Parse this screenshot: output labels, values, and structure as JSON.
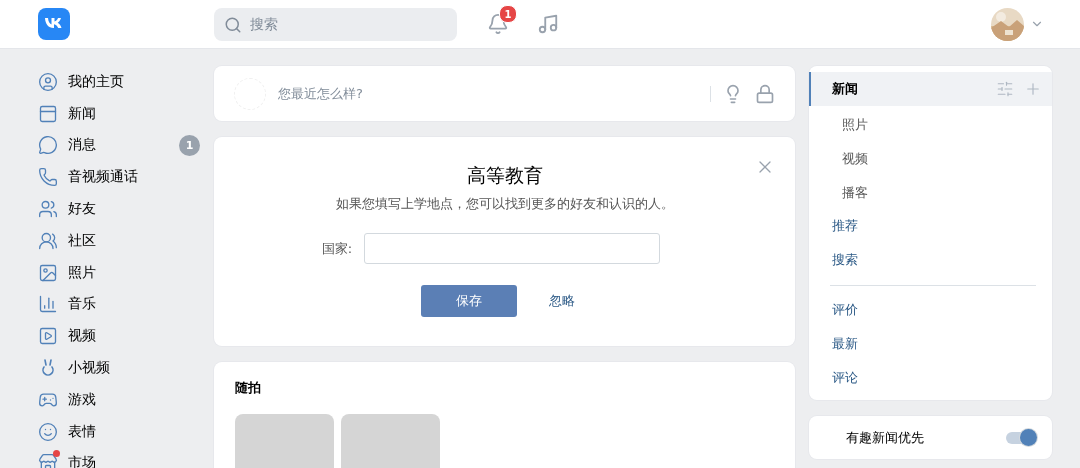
{
  "header": {
    "search": {
      "placeholder": "搜索"
    },
    "notifications": {
      "count": "1"
    }
  },
  "sidebar": {
    "items": [
      {
        "label": "我的主页",
        "dot": false
      },
      {
        "label": "新闻",
        "dot": false
      },
      {
        "label": "消息",
        "badge": "1",
        "dot": false
      },
      {
        "label": "音视频通话",
        "dot": false
      },
      {
        "label": "好友",
        "dot": false
      },
      {
        "label": "社区",
        "dot": false
      },
      {
        "label": "照片",
        "dot": false
      },
      {
        "label": "音乐",
        "dot": false
      },
      {
        "label": "视频",
        "dot": false
      },
      {
        "label": "小视频",
        "dot": false
      },
      {
        "label": "游戏",
        "dot": false
      },
      {
        "label": "表情",
        "dot": false
      },
      {
        "label": "市场",
        "dot": true
      }
    ]
  },
  "composer": {
    "placeholder": "您最近怎么样?"
  },
  "education_card": {
    "title": "高等教育",
    "subtitle": "如果您填写上学地点，您可以找到更多的好友和认识的人。",
    "field_label": "国家:",
    "save_button": "保存",
    "ignore_link": "忽略"
  },
  "stories_card": {
    "title": "随拍"
  },
  "feed_menu": {
    "sections": [
      [
        {
          "label": "新闻",
          "kind": "header",
          "selected": true
        },
        {
          "label": "照片",
          "kind": "sub",
          "selected": false
        },
        {
          "label": "视频",
          "kind": "sub",
          "selected": false
        },
        {
          "label": "播客",
          "kind": "sub",
          "selected": false
        },
        {
          "label": "推荐",
          "kind": "link",
          "selected": false
        },
        {
          "label": "搜索",
          "kind": "link",
          "selected": false
        }
      ],
      [
        {
          "label": "评价",
          "kind": "link",
          "selected": false
        },
        {
          "label": "最新",
          "kind": "link",
          "selected": false
        },
        {
          "label": "评论",
          "kind": "link",
          "selected": false
        }
      ]
    ]
  },
  "interesting_first": {
    "label": "有趣新闻优先",
    "on": true
  }
}
